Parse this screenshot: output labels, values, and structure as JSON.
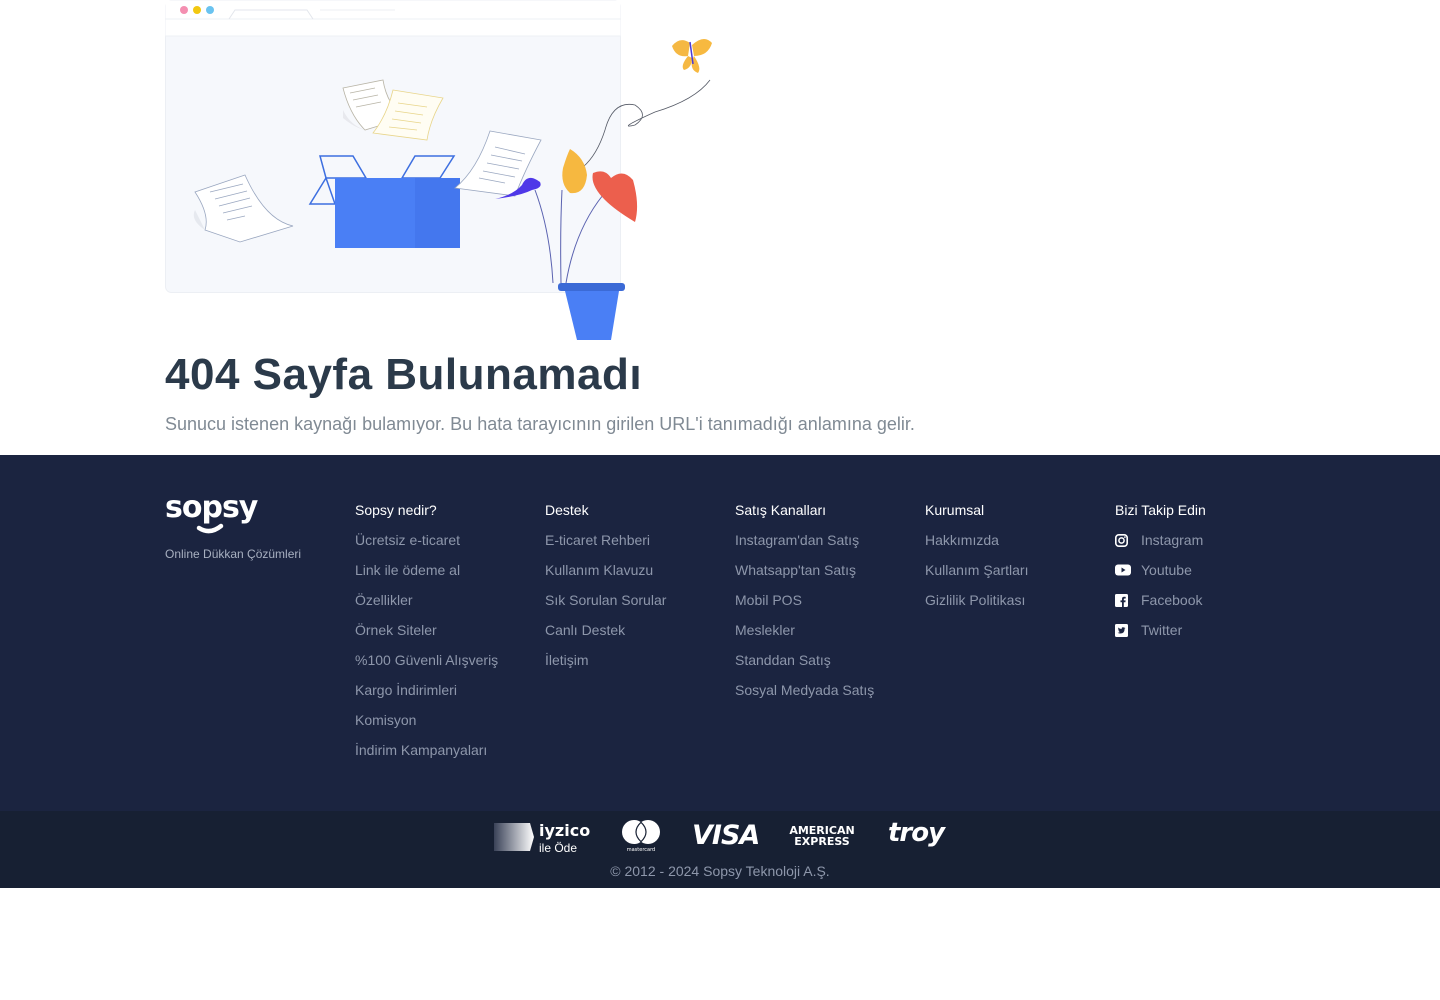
{
  "error_page": {
    "title": "404 Sayfa Bulunamadı",
    "description": "Sunucu istenen kaynağı bulamıyor. Bu hata tarayıcının girilen URL'i tanımadığı anlamına gelir.",
    "illustration": "empty-box-with-flying-papers-and-plant-illustration"
  },
  "footer": {
    "brand": {
      "logo_text": "sopsy",
      "tagline": "Online Dükkan Çözümleri"
    },
    "columns": [
      {
        "title": "Sopsy nedir?",
        "links": [
          "Ücretsiz e-ticaret",
          "Link ile ödeme al",
          "Özellikler",
          "Örnek Siteler",
          "%100 Güvenli Alışveriş",
          "Kargo İndirimleri",
          "Komisyon",
          "İndirim Kampanyaları"
        ]
      },
      {
        "title": "Destek",
        "links": [
          "E-ticaret Rehberi",
          "Kullanım Klavuzu",
          "Sık Sorulan Sorular",
          "Canlı Destek",
          "İletişim"
        ]
      },
      {
        "title": "Satış Kanalları",
        "links": [
          "Instagram'dan Satış",
          "Whatsapp'tan Satış",
          "Mobil POS",
          "Meslekler",
          "Standdan Satış",
          "Sosyal Medyada Satış"
        ]
      },
      {
        "title": "Kurumsal",
        "links": [
          "Hakkımızda",
          "Kullanım Şartları",
          "Gizlilik Politikası"
        ]
      }
    ],
    "social": {
      "title": "Bizi Takip Edin",
      "links": [
        {
          "label": "Instagram",
          "icon": "instagram-icon"
        },
        {
          "label": "Youtube",
          "icon": "youtube-icon"
        },
        {
          "label": "Facebook",
          "icon": "facebook-icon"
        },
        {
          "label": "Twitter",
          "icon": "twitter-icon"
        }
      ]
    },
    "payments": {
      "iyzico": {
        "name": "iyzico",
        "sub": "ile Öde"
      },
      "mastercard": "mastercard",
      "visa": "VISA",
      "amex": [
        "AMERICAN",
        "EXPRESS"
      ],
      "troy": "troy"
    },
    "copyright": "© 2012 - 2024 Sopsy Teknoloji A.Ş."
  },
  "colors": {
    "footer_bg": "#1b2440",
    "footer_bottom_bg": "#172033",
    "title_text": "#2b3a4a",
    "muted_text": "#808a94",
    "link_text": "#8e97ab",
    "box_blue": "#4a7ff5"
  }
}
